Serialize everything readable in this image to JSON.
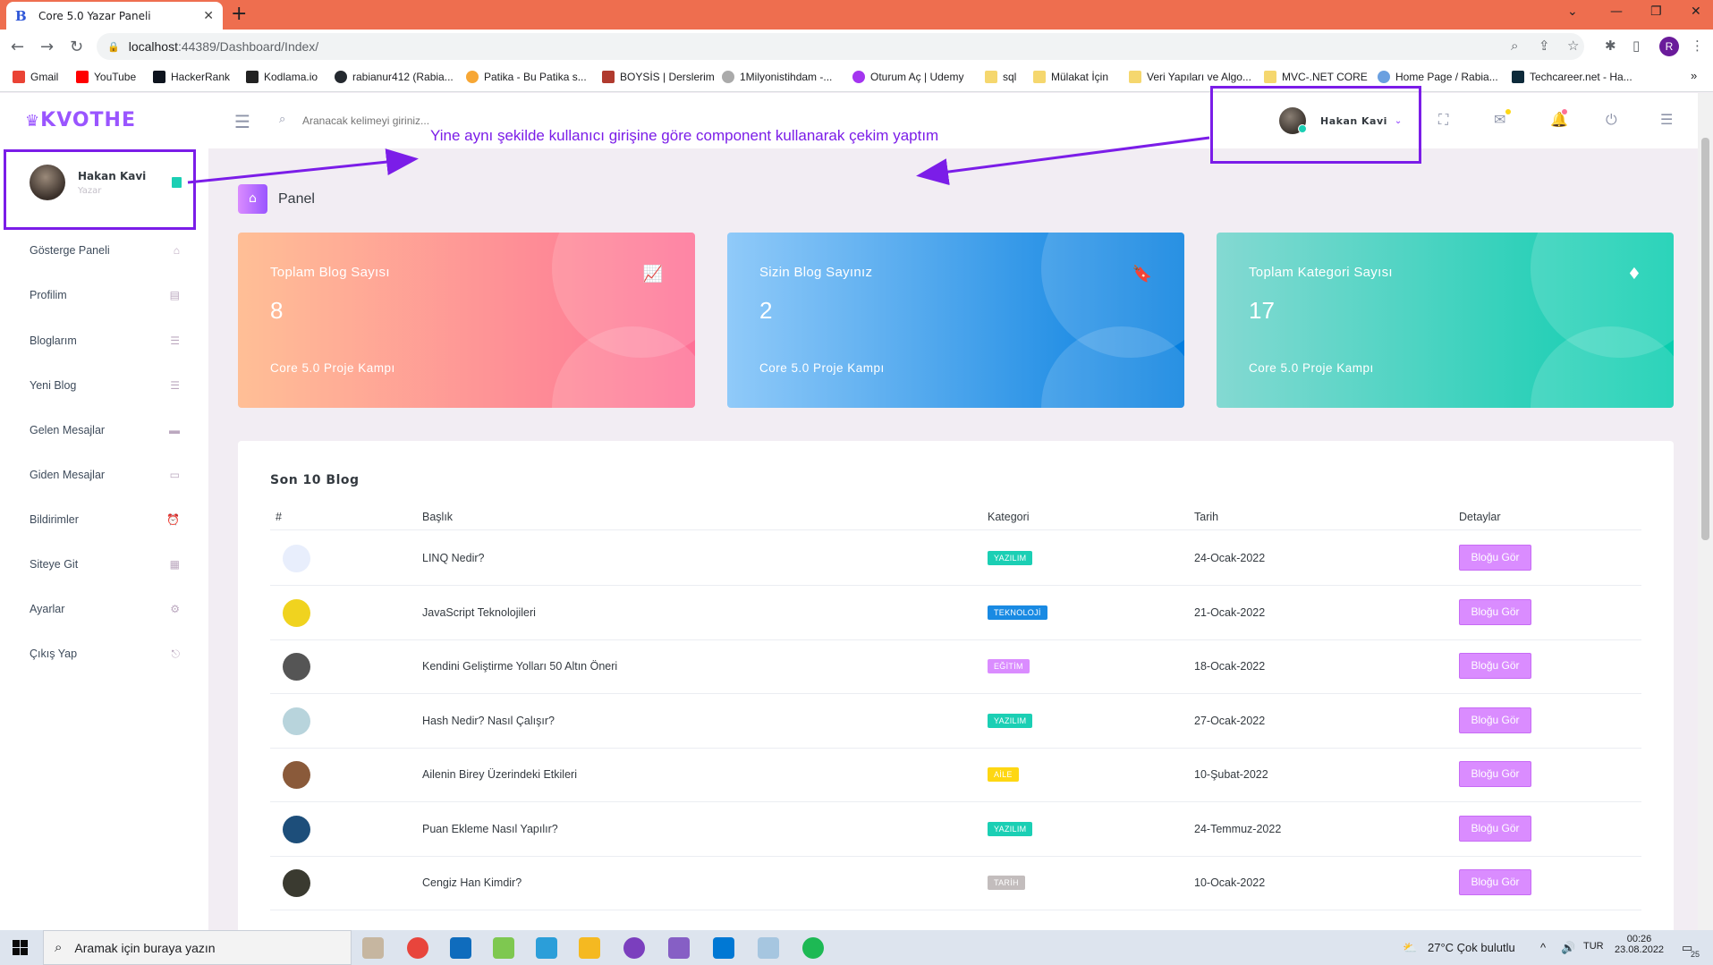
{
  "browser": {
    "tab_title": "Core 5.0 Yazar Paneli",
    "tab_favicon": "B",
    "url_host": "localhost",
    "url_path": ":44389/Dashboard/Index/",
    "profile_initial": "R",
    "bookmarks": [
      {
        "label": "Gmail",
        "color": "#ea4335"
      },
      {
        "label": "YouTube",
        "color": "#ff0000"
      },
      {
        "label": "HackerRank",
        "color": "#0e141e"
      },
      {
        "label": "Kodlama.io",
        "color": "#222222"
      },
      {
        "label": "rabianur412 (Rabia...",
        "color": "#24292f"
      },
      {
        "label": "Patika - Bu Patika s...",
        "color": "#f7a735"
      },
      {
        "label": "BOYSİS | Derslerim",
        "color": "#b03a2e"
      },
      {
        "label": "1Milyonistihdam -...",
        "color": "#888888"
      },
      {
        "label": "Oturum Aç | Udemy",
        "color": "#a435f0"
      },
      {
        "label": "sql",
        "color": "#f5d76e"
      },
      {
        "label": "Mülakat İçin",
        "color": "#f5d76e"
      },
      {
        "label": "Veri Yapıları ve Algo...",
        "color": "#f5d76e"
      },
      {
        "label": "MVC-.NET CORE",
        "color": "#f5d76e"
      },
      {
        "label": "Home Page / Rabia...",
        "color": "#6aa0e0"
      },
      {
        "label": "Techcareer.net - Ha...",
        "color": "#0d2a3a"
      }
    ]
  },
  "app": {
    "logo": "KVOTHE",
    "search_placeholder": "Aranacak kelimeyi giriniz...",
    "header_user": "Hakan Kavi",
    "sidebar": {
      "user_name": "Hakan Kavi",
      "user_role": "Yazar",
      "items": [
        {
          "label": "Gösterge Paneli",
          "icon": "home-icon"
        },
        {
          "label": "Profilim",
          "icon": "id-card-icon"
        },
        {
          "label": "Bloglarım",
          "icon": "list-icon"
        },
        {
          "label": "Yeni Blog",
          "icon": "list-icon"
        },
        {
          "label": "Gelen Mesajlar",
          "icon": "message-icon"
        },
        {
          "label": "Giden Mesajlar",
          "icon": "message-outline-icon"
        },
        {
          "label": "Bildirimler",
          "icon": "alarm-icon"
        },
        {
          "label": "Siteye Git",
          "icon": "grid-icon"
        },
        {
          "label": "Ayarlar",
          "icon": "gear-icon"
        },
        {
          "label": "Çıkış Yap",
          "icon": "logout-icon"
        }
      ]
    },
    "page_title": "Panel",
    "cards": [
      {
        "title": "Toplam Blog Sayısı",
        "value": "8",
        "subtitle": "Core 5.0 Proje Kampı",
        "icon": "chart-line-icon"
      },
      {
        "title": "Sizin Blog Sayınız",
        "value": "2",
        "subtitle": "Core 5.0 Proje Kampı",
        "icon": "bookmark-icon"
      },
      {
        "title": "Toplam Kategori Sayısı",
        "value": "17",
        "subtitle": "Core 5.0 Proje Kampı",
        "icon": "diamond-icon"
      }
    ],
    "table": {
      "title": "Son 10 Blog",
      "columns": [
        "#",
        "Başlık",
        "Kategori",
        "Tarih",
        "Detaylar"
      ],
      "rows": [
        {
          "title": "LINQ Nedir?",
          "category": "YAZILIM",
          "cat_color": "#1bcfb4",
          "date": "24-Ocak-2022",
          "button": "Bloğu Gör",
          "img_color": "#e8eefc"
        },
        {
          "title": "JavaScript Teknolojileri",
          "category": "TEKNOLOJİ",
          "cat_color": "#198ae3",
          "date": "21-Ocak-2022",
          "button": "Bloğu Gör",
          "img_color": "#f0d31f"
        },
        {
          "title": "Kendini Geliştirme Yolları 50 Altın Öneri",
          "category": "EĞİTİM",
          "cat_color": "#da8cff",
          "date": "18-Ocak-2022",
          "button": "Bloğu Gör",
          "img_color": "#555555"
        },
        {
          "title": "Hash Nedir? Nasıl Çalışır?",
          "category": "YAZILIM",
          "cat_color": "#1bcfb4",
          "date": "27-Ocak-2022",
          "button": "Bloğu Gör",
          "img_color": "#b8d4dc"
        },
        {
          "title": "Ailenin Birey Üzerindeki Etkileri",
          "category": "AİLE",
          "cat_color": "#fed713",
          "date": "10-Şubat-2022",
          "button": "Bloğu Gör",
          "img_color": "#8a5a3a"
        },
        {
          "title": "Puan Ekleme Nasıl Yapılır?",
          "category": "YAZILIM",
          "cat_color": "#1bcfb4",
          "date": "24-Temmuz-2022",
          "button": "Bloğu Gör",
          "img_color": "#1d4e7a"
        },
        {
          "title": "Cengiz Han Kimdir?",
          "category": "TARİH",
          "cat_color": "#c3bdbd",
          "date": "10-Ocak-2022",
          "button": "Bloğu Gör",
          "img_color": "#3a3a30"
        }
      ]
    }
  },
  "annotation": {
    "text": "Yine aynı şekilde kullanıcı girişine göre component kullanarak çekim yaptım",
    "color": "#7b1de8"
  },
  "taskbar": {
    "search_placeholder": "Aramak için buraya yazın",
    "weather": "27°C  Çok bulutlu",
    "lang": "TUR",
    "time": "00:26",
    "date": "23.08.2022",
    "notifications": "25"
  }
}
